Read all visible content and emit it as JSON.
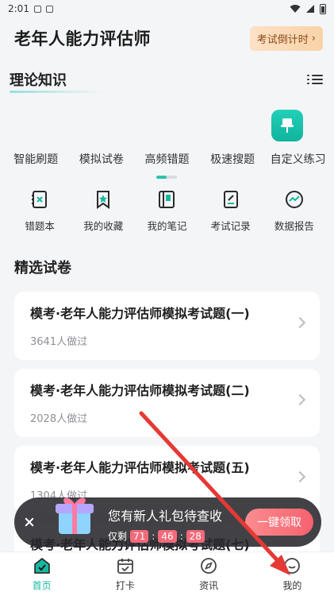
{
  "status_bar": {
    "time": "2:01"
  },
  "header": {
    "title": "老年人能力评估师",
    "countdown_label": "考试倒计时",
    "countdown_chevron": "›"
  },
  "theory": {
    "title": "理论知识",
    "menu_icon": "list-icon"
  },
  "practice": {
    "items": [
      {
        "label": "智能刷题"
      },
      {
        "label": "模拟试卷"
      },
      {
        "label": "高频错题"
      },
      {
        "label": "极速搜题"
      },
      {
        "label": "自定义练习",
        "icon": "pin-icon"
      }
    ],
    "page_indicator_fill": 0.5
  },
  "tools": [
    {
      "label": "错题本",
      "icon": "wrong-book-icon"
    },
    {
      "label": "我的收藏",
      "icon": "bookmark-star-icon"
    },
    {
      "label": "我的笔记",
      "icon": "notebook-icon"
    },
    {
      "label": "考试记录",
      "icon": "exam-record-icon"
    },
    {
      "label": "数据报告",
      "icon": "data-report-icon"
    }
  ],
  "featured": {
    "title": "精选试卷",
    "papers": [
      {
        "title": "模考·老年人能力评估师模拟考试题(一)",
        "count": "3641人做过"
      },
      {
        "title": "模考·老年人能力评估师模拟考试题(二)",
        "count": "2028人做过"
      },
      {
        "title": "模考·老年人能力评估师模拟考试题(五)",
        "count": "1304人做过"
      },
      {
        "title": "模考·老年人能力评估师模拟考试题(七)",
        "count": ""
      }
    ]
  },
  "promo": {
    "message": "您有新人礼包待查收",
    "remaining_label": "仅剩",
    "timer": [
      "71",
      "46",
      "28"
    ],
    "button_label": "一键领取"
  },
  "nav": [
    {
      "label": "首页",
      "icon": "home-icon",
      "active": true
    },
    {
      "label": "打卡",
      "icon": "calendar-check-icon",
      "active": false
    },
    {
      "label": "资讯",
      "icon": "compass-icon",
      "active": false
    },
    {
      "label": "我的",
      "icon": "profile-icon",
      "active": false
    }
  ],
  "colors": {
    "accent": "#18b89f",
    "countdown_text": "#8a4a18",
    "promo_button": "#f6626f",
    "arrow": "#e53935"
  }
}
